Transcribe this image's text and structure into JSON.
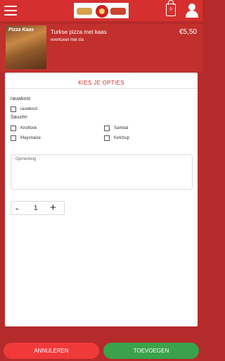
{
  "header": {
    "cart_count": "0",
    "icons": [
      "hamburger-menu-icon",
      "logo",
      "shopping-bag-icon",
      "user-icon"
    ]
  },
  "product": {
    "image_label": "Pizza Kaas",
    "name": "Turkse pizza met kaas",
    "description": "eventueel met sla",
    "price": "€5,50"
  },
  "modal": {
    "title": "KIES JE OPTIES",
    "groups": [
      {
        "label": "rauwkost",
        "options": [
          {
            "label": "rauwkost",
            "checked": false
          }
        ]
      },
      {
        "label": "Sauzen",
        "options": [
          {
            "label": "Knoflook",
            "checked": false
          },
          {
            "label": "Sambal",
            "checked": false
          },
          {
            "label": "Mayonaise",
            "checked": false
          },
          {
            "label": "Ketchup",
            "checked": false
          }
        ]
      }
    ],
    "remark_label": "Opmerking",
    "quantity": {
      "minus": "-",
      "value": "1",
      "plus": "+"
    }
  },
  "buttons": {
    "cancel": "ANNULEREN",
    "add": "TOEVOEGEN"
  },
  "colors": {
    "header_red": "#d5302f",
    "cancel_red": "#f03a3a",
    "add_green": "#3aa24a",
    "title_red": "#d32f2f"
  }
}
